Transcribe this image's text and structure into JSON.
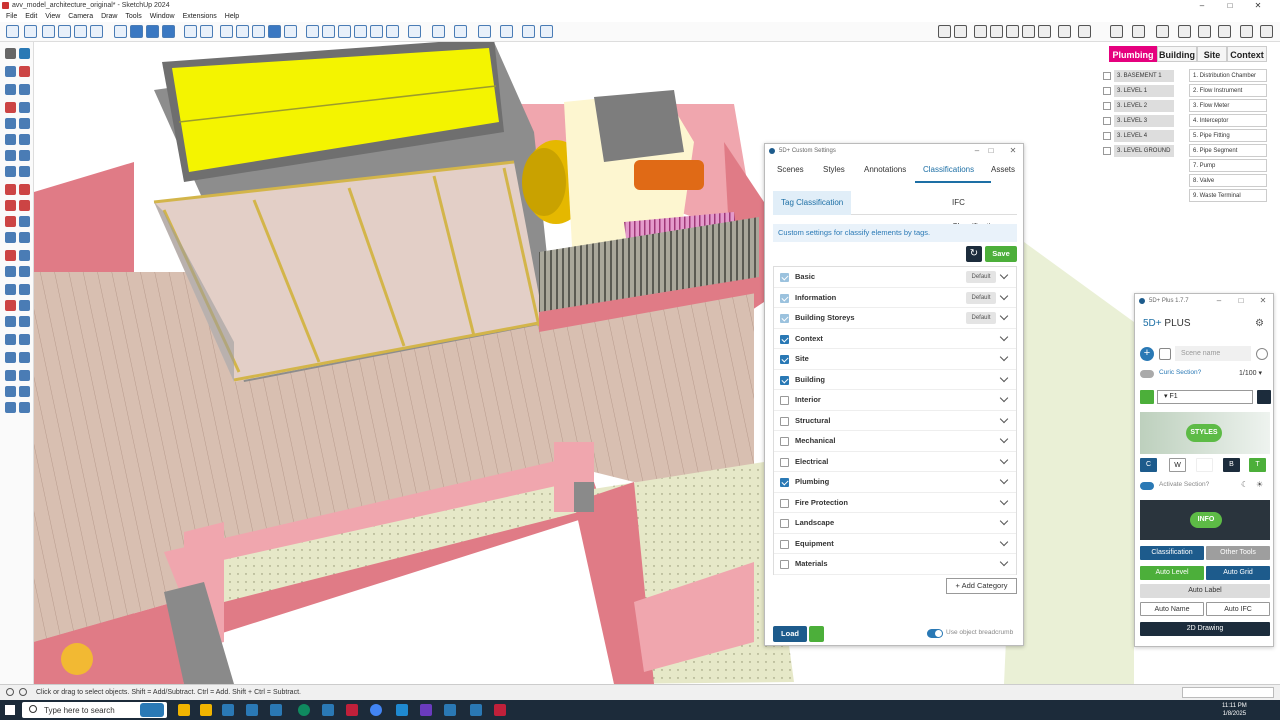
{
  "window": {
    "title": "avv_model_architecture_original* - SketchUp 2024",
    "min": "–",
    "max": "□",
    "close": "✕"
  },
  "menu": [
    "File",
    "Edit",
    "View",
    "Camera",
    "Draw",
    "Tools",
    "Window",
    "Extensions",
    "Help"
  ],
  "layer_tabs": [
    {
      "label": "Plumbing",
      "active": true
    },
    {
      "label": "Building",
      "active": false
    },
    {
      "label": "Site",
      "active": false
    },
    {
      "label": "Context",
      "active": false
    }
  ],
  "levels": [
    "3. BASEMENT 1",
    "3. LEVEL 1",
    "3. LEVEL 2",
    "3. LEVEL 3",
    "3. LEVEL 4",
    "3. LEVEL GROUND"
  ],
  "plumbing_types": [
    "1. Distribution Chamber",
    "2. Flow Instrument",
    "3. Flow Meter",
    "4. Interceptor",
    "5. Pipe Fitting",
    "6. Pipe Segment",
    "7. Pump",
    "8. Valve",
    "9. Waste Terminal"
  ],
  "custom_settings": {
    "title": "5D+ Custom Settings",
    "tabs": [
      {
        "label": "Scenes",
        "active": false
      },
      {
        "label": "Styles",
        "active": false
      },
      {
        "label": "Annotations",
        "active": false
      },
      {
        "label": "Classifications",
        "active": true
      },
      {
        "label": "Assets",
        "active": false
      }
    ],
    "subtabs": {
      "tag": "Tag Classification",
      "ifc": "IFC Classification"
    },
    "info": "Custom settings for classify elements by tags.",
    "refresh_icon": "↻",
    "save_label": "Save",
    "default_badge": "Default",
    "categories": [
      {
        "name": "Basic",
        "state": "default"
      },
      {
        "name": "Information",
        "state": "default"
      },
      {
        "name": "Building Storeys",
        "state": "default"
      },
      {
        "name": "Context",
        "state": "checked"
      },
      {
        "name": "Site",
        "state": "checked"
      },
      {
        "name": "Building",
        "state": "checked"
      },
      {
        "name": "Interior",
        "state": "unchecked"
      },
      {
        "name": "Structural",
        "state": "unchecked"
      },
      {
        "name": "Mechanical",
        "state": "unchecked"
      },
      {
        "name": "Electrical",
        "state": "unchecked"
      },
      {
        "name": "Plumbing",
        "state": "checked"
      },
      {
        "name": "Fire Protection",
        "state": "unchecked"
      },
      {
        "name": "Landscape",
        "state": "unchecked"
      },
      {
        "name": "Equipment",
        "state": "unchecked"
      },
      {
        "name": "Materials",
        "state": "unchecked"
      }
    ],
    "add_category": "+ Add Category",
    "load_label": "Load",
    "breadcrumb_label": "Use object breadcrumb"
  },
  "plus_panel": {
    "title": "5D+ Plus 1.7.7",
    "brand_prefix": "5D+",
    "brand_suffix": "PLUS",
    "scene_placeholder": "Scene name",
    "curic_section": "Curic Section?",
    "scale": "1/100 ▾",
    "layer_value": "F1",
    "styles_label": "STYLES",
    "style_buttons": [
      "C",
      "W",
      "",
      "B",
      "T"
    ],
    "activate_section": "Activate Section?",
    "info_label": "INFO",
    "buttons": {
      "classification": "Classification",
      "other_tools": "Other Tools",
      "auto_level": "Auto Level",
      "auto_grid": "Auto Grid",
      "auto_label": "Auto Label",
      "auto_name": "Auto Name",
      "auto_ifc": "Auto IFC",
      "drawing_2d": "2D Drawing"
    }
  },
  "status": {
    "text": "Click or drag to select objects. Shift = Add/Subtract. Ctrl = Add. Shift + Ctrl = Subtract."
  },
  "taskbar": {
    "search": "Type here to search",
    "time": "11:11 PM",
    "date": "1/8/2025"
  }
}
